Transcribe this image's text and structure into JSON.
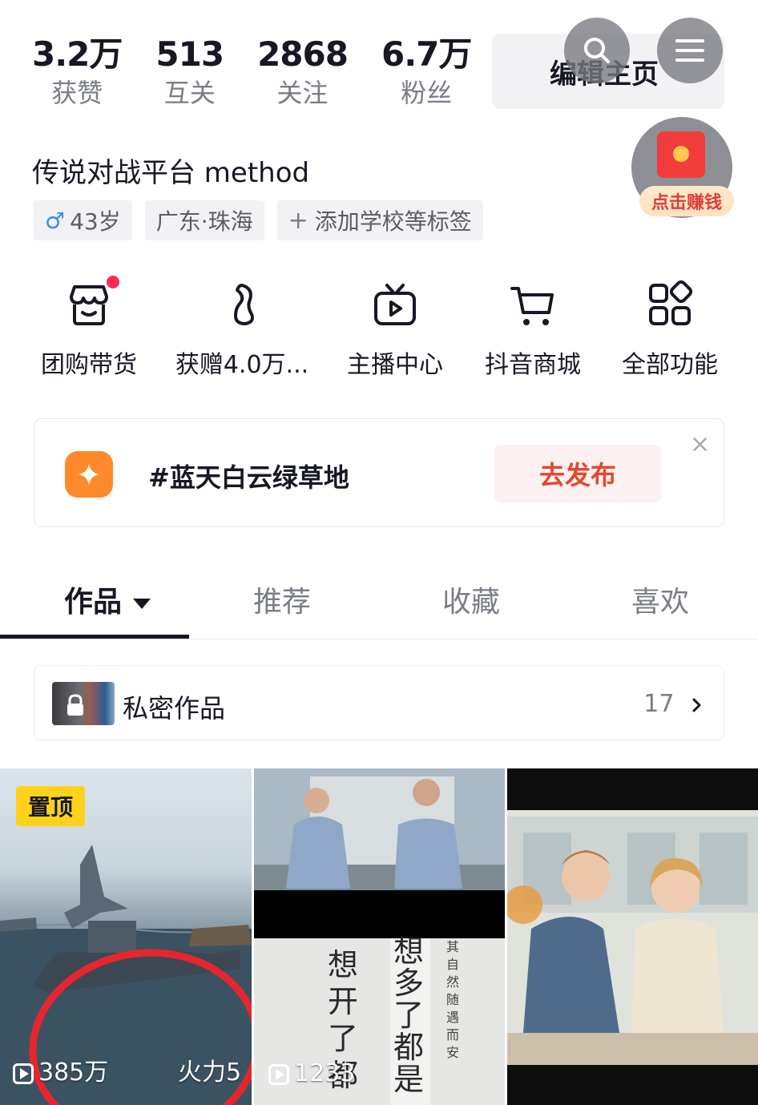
{
  "stats": [
    {
      "value": "3.2万",
      "label": "获赞"
    },
    {
      "value": "513",
      "label": "互关"
    },
    {
      "value": "2868",
      "label": "关注"
    },
    {
      "value": "6.7万",
      "label": "粉丝"
    }
  ],
  "header": {
    "edit_label": "编辑主页",
    "earn_label": "点击赚钱"
  },
  "profile": {
    "username": "传说对战平台 method",
    "tags": {
      "age": "43岁",
      "location": "广东·珠海",
      "add_tag": "添加学校等标签"
    }
  },
  "functions": [
    {
      "label": "团购带货",
      "icon": "shop-icon"
    },
    {
      "label": "获赠4.0万...",
      "icon": "leaf-icon"
    },
    {
      "label": "主播中心",
      "icon": "tv-icon"
    },
    {
      "label": "抖音商城",
      "icon": "cart-icon"
    },
    {
      "label": "全部功能",
      "icon": "grid-icon"
    }
  ],
  "topic": {
    "text": "#蓝天白云绿草地",
    "button": "去发布",
    "close": "×"
  },
  "tabs": {
    "works": "作品",
    "recommend": "推荐",
    "favorites": "收藏",
    "likes": "喜欢"
  },
  "private": {
    "label": "私密作品",
    "count": "17"
  },
  "videos": [
    {
      "pinned": "置顶",
      "views": "385万",
      "fire": "火力5"
    },
    {
      "views": "1233",
      "calligraphy": [
        "想开了都",
        "想多了都是",
        "其自然 随遇而安"
      ]
    },
    {}
  ],
  "colors": {
    "accent_red": "#fe2c55",
    "pinned_yellow": "#ffd11a",
    "topic_orange": "#ff8a2b",
    "publish_text": "#e0492f"
  }
}
